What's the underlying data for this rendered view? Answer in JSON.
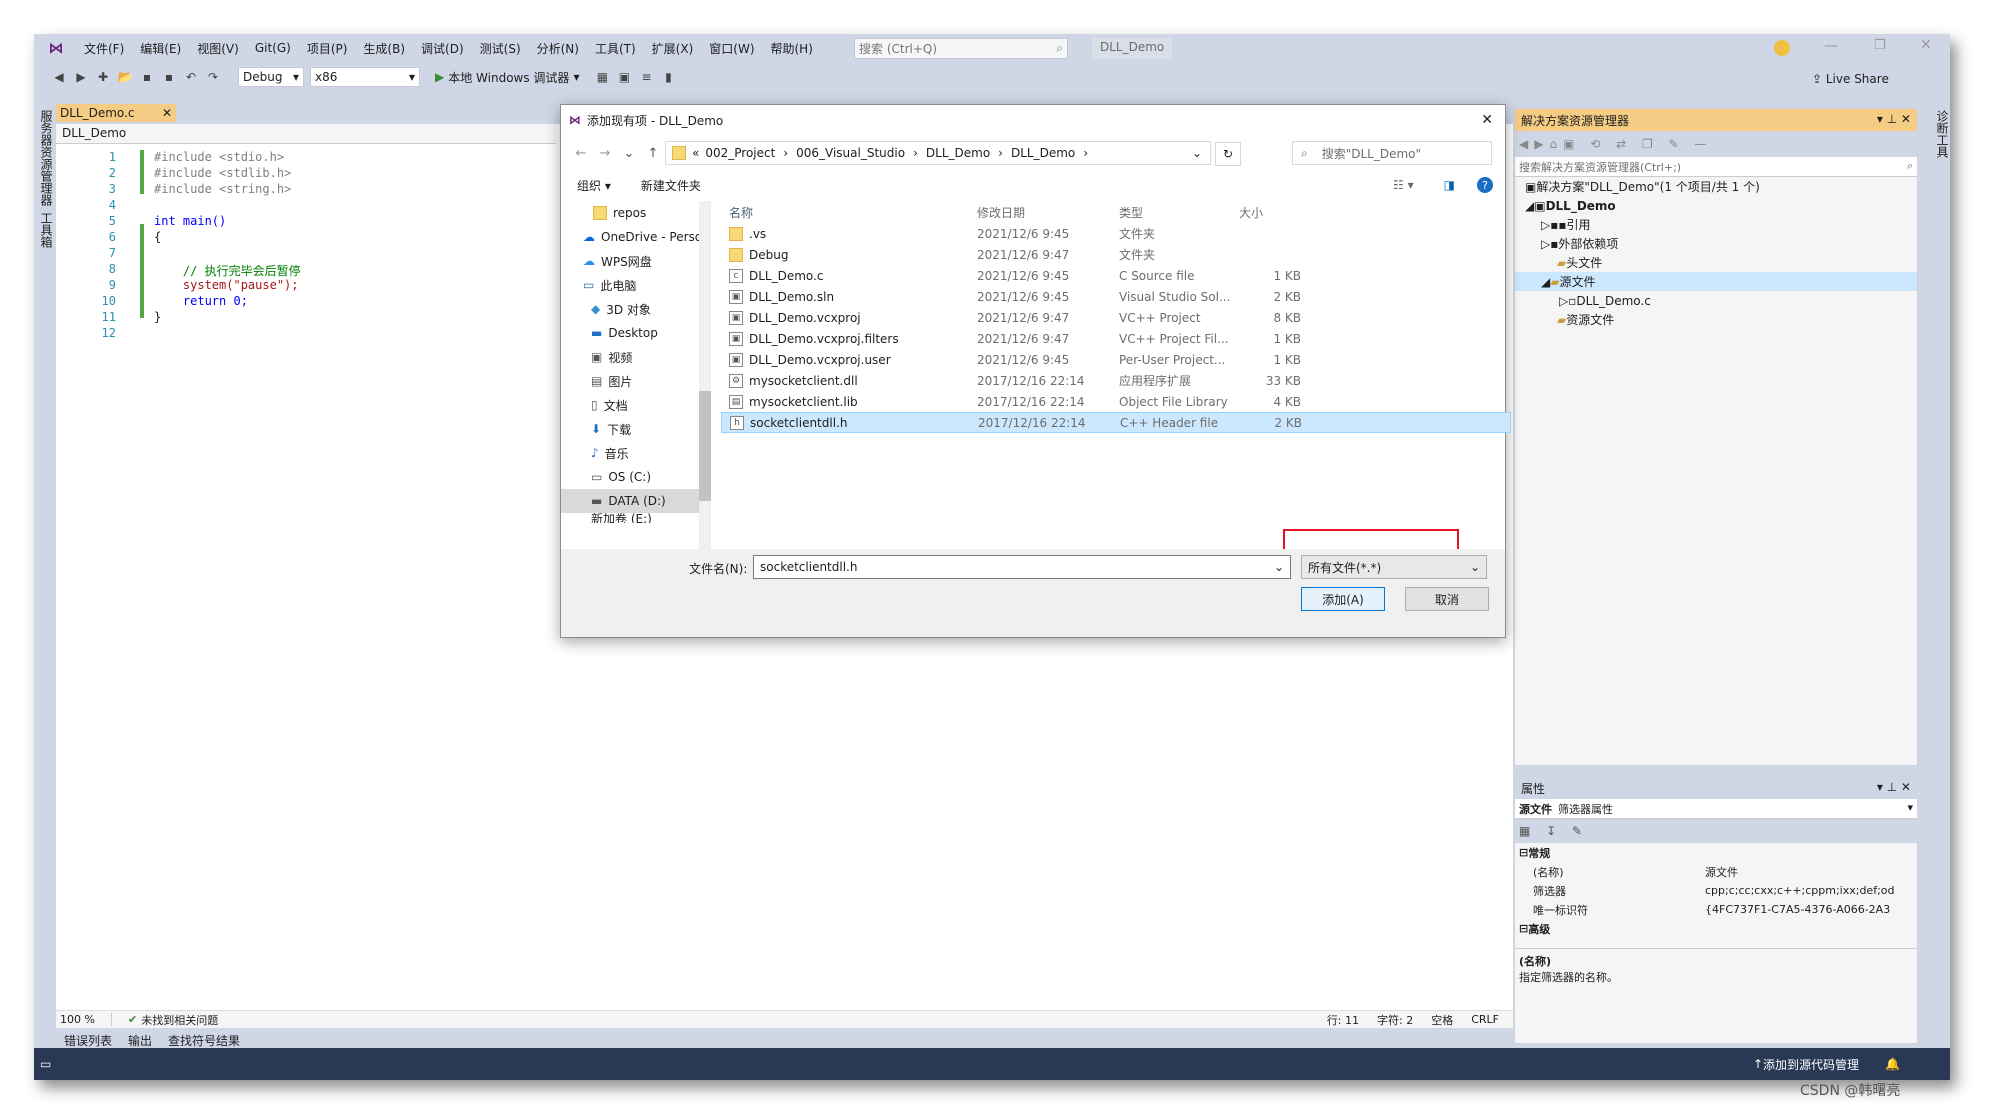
{
  "menubar": {
    "items": [
      "文件(F)",
      "编辑(E)",
      "视图(V)",
      "Git(G)",
      "项目(P)",
      "生成(B)",
      "调试(D)",
      "测试(S)",
      "分析(N)",
      "工具(T)",
      "扩展(X)",
      "窗口(W)",
      "帮助(H)"
    ],
    "search_placeholder": "搜索 (Ctrl+Q)",
    "solution_name": "DLL_Demo"
  },
  "toolbar": {
    "config": "Debug",
    "platform": "x86",
    "run_label": "本地 Windows 调试器",
    "live_share": "Live Share"
  },
  "left_strip": {
    "server_explorer": "服务器资源管理器",
    "toolbox": "工具箱"
  },
  "right_strip": {
    "diagnostics": "诊断工具"
  },
  "editor": {
    "tab": "DLL_Demo.c",
    "scope_combo": "DLL_Demo",
    "zoom": "100 %",
    "issues": "未找到相关问题",
    "line": "行: 11",
    "char": "字符: 2",
    "indent": "空格",
    "eol": "CRLF",
    "code_lines": [
      "#include <stdio.h>",
      "#include <stdlib.h>",
      "#include <string.h>",
      "",
      "int main()",
      "{",
      "",
      "    // 执行完毕会后暂停",
      "    system(\"pause\");",
      "    return 0;",
      "}",
      ""
    ]
  },
  "output_tabs": [
    "错误列表",
    "输出",
    "查找符号结果"
  ],
  "statusbar": {
    "source_control": "添加到源代码管理",
    "watermark": "CSDN @韩曙亮"
  },
  "solution_explorer": {
    "title": "解决方案资源管理器",
    "search_placeholder": "搜索解决方案资源管理器(Ctrl+;)",
    "tree": [
      {
        "label": "解决方案\"DLL_Demo\"(1 个项目/共 1 个)",
        "depth": 0
      },
      {
        "label": "DLL_Demo",
        "depth": 1
      },
      {
        "label": "引用",
        "depth": 2
      },
      {
        "label": "外部依赖项",
        "depth": 2
      },
      {
        "label": "头文件",
        "depth": 2
      },
      {
        "label": "源文件",
        "depth": 2
      },
      {
        "label": "DLL_Demo.c",
        "depth": 3
      },
      {
        "label": "资源文件",
        "depth": 2
      }
    ]
  },
  "properties": {
    "title": "属性",
    "object": "源文件",
    "object_type": "筛选器属性",
    "cat_general": "常规",
    "cat_advanced": "高级",
    "rows": [
      {
        "key": "(名称)",
        "value": "源文件"
      },
      {
        "key": "筛选器",
        "value": "cpp;c;cc;cxx;c++;cppm;ixx;def;od"
      },
      {
        "key": "唯一标识符",
        "value": "{4FC737F1-C7A5-4376-A066-2A3"
      }
    ],
    "desc_title": "(名称)",
    "desc_text": "指定筛选器的名称。"
  },
  "dialog": {
    "title": "添加现有项 - DLL_Demo",
    "breadcrumb": [
      "002_Project",
      "006_Visual_Studio",
      "DLL_Demo",
      "DLL_Demo"
    ],
    "search_placeholder": "搜索\"DLL_Demo\"",
    "organize": "组织 ▾",
    "new_folder": "新建文件夹",
    "nav": [
      "repos",
      "OneDrive - Perso",
      "WPS网盘",
      "此电脑",
      "3D 对象",
      "Desktop",
      "视频",
      "图片",
      "文档",
      "下载",
      "音乐",
      "OS (C:)",
      "DATA (D:)",
      "新加卷 (E:)"
    ],
    "columns": [
      "名称",
      "修改日期",
      "类型",
      "大小"
    ],
    "files": [
      {
        "name": ".vs",
        "date": "2021/12/6 9:45",
        "type": "文件夹",
        "size": "",
        "icon": "folder"
      },
      {
        "name": "Debug",
        "date": "2021/12/6 9:47",
        "type": "文件夹",
        "size": "",
        "icon": "folder"
      },
      {
        "name": "DLL_Demo.c",
        "date": "2021/12/6 9:45",
        "type": "C Source file",
        "size": "1 KB",
        "icon": "c-file"
      },
      {
        "name": "DLL_Demo.sln",
        "date": "2021/12/6 9:45",
        "type": "Visual Studio Sol...",
        "size": "2 KB",
        "icon": "sln-file"
      },
      {
        "name": "DLL_Demo.vcxproj",
        "date": "2021/12/6 9:47",
        "type": "VC++ Project",
        "size": "8 KB",
        "icon": "proj-file"
      },
      {
        "name": "DLL_Demo.vcxproj.filters",
        "date": "2021/12/6 9:47",
        "type": "VC++ Project Fil...",
        "size": "1 KB",
        "icon": "proj-file"
      },
      {
        "name": "DLL_Demo.vcxproj.user",
        "date": "2021/12/6 9:45",
        "type": "Per-User Project...",
        "size": "1 KB",
        "icon": "proj-file"
      },
      {
        "name": "mysocketclient.dll",
        "date": "2017/12/16 22:14",
        "type": "应用程序扩展",
        "size": "33 KB",
        "icon": "dll-file"
      },
      {
        "name": "mysocketclient.lib",
        "date": "2017/12/16 22:14",
        "type": "Object File Library",
        "size": "4 KB",
        "icon": "lib-file"
      },
      {
        "name": "socketclientdll.h",
        "date": "2017/12/16 22:14",
        "type": "C++ Header file",
        "size": "2 KB",
        "icon": "h-file",
        "selected": true
      }
    ],
    "filename_label": "文件名(N):",
    "filename_value": "socketclientdll.h",
    "filter": "所有文件(*.*)",
    "add_button": "添加(A)",
    "cancel_button": "取消"
  }
}
